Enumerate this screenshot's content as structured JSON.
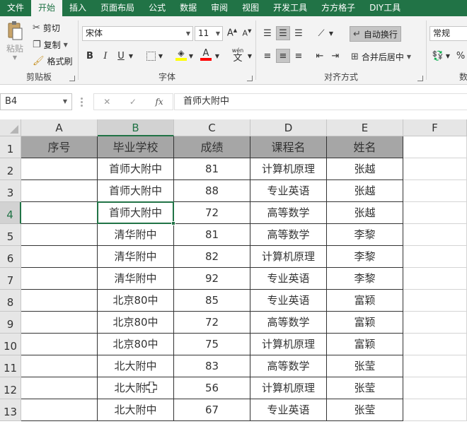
{
  "menu": {
    "tabs": [
      "文件",
      "开始",
      "插入",
      "页面布局",
      "公式",
      "数据",
      "审阅",
      "视图",
      "开发工具",
      "方方格子",
      "DIY工具"
    ],
    "active": "开始"
  },
  "clipboard": {
    "paste": "粘贴",
    "cut": "剪切",
    "copy": "复制",
    "format_painter": "格式刷",
    "label": "剪贴板"
  },
  "font": {
    "name": "宋体",
    "size": "11",
    "bold": "B",
    "italic": "I",
    "underline": "U",
    "wen": "wén",
    "label": "字体",
    "fill_color": "#ffff00",
    "font_color": "#ff0000"
  },
  "alignment": {
    "wrap_text": "自动换行",
    "merge_center": "合并后居中",
    "label": "对齐方式"
  },
  "number": {
    "format": "常规",
    "percent": "%",
    "label": "数"
  },
  "formula_bar": {
    "name_box": "B4",
    "cancel": "✕",
    "enter": "✓",
    "fx": "fx",
    "content": "首师大附中"
  },
  "sheet": {
    "columns": [
      "A",
      "B",
      "C",
      "D",
      "E",
      "F"
    ],
    "rows": [
      "1",
      "2",
      "3",
      "4",
      "5",
      "6",
      "7",
      "8",
      "9",
      "10",
      "11",
      "12",
      "13"
    ],
    "headers": [
      "序号",
      "毕业学校",
      "成绩",
      "课程名",
      "姓名"
    ],
    "data": [
      [
        "",
        "首师大附中",
        "81",
        "计算机原理",
        "张越"
      ],
      [
        "",
        "首师大附中",
        "88",
        "专业英语",
        "张越"
      ],
      [
        "",
        "首师大附中",
        "72",
        "高等数学",
        "张越"
      ],
      [
        "",
        "清华附中",
        "81",
        "高等数学",
        "李黎"
      ],
      [
        "",
        "清华附中",
        "82",
        "计算机原理",
        "李黎"
      ],
      [
        "",
        "清华附中",
        "92",
        "专业英语",
        "李黎"
      ],
      [
        "",
        "北京80中",
        "85",
        "专业英语",
        "富颖"
      ],
      [
        "",
        "北京80中",
        "72",
        "高等数学",
        "富颖"
      ],
      [
        "",
        "北京80中",
        "75",
        "计算机原理",
        "富颖"
      ],
      [
        "",
        "北大附中",
        "83",
        "高等数学",
        "张莹"
      ],
      [
        "",
        "北大附中",
        "56",
        "计算机原理",
        "张莹"
      ],
      [
        "",
        "北大附中",
        "67",
        "专业英语",
        "张莹"
      ]
    ],
    "active_cell": "B4",
    "accent_color": "#217346"
  }
}
